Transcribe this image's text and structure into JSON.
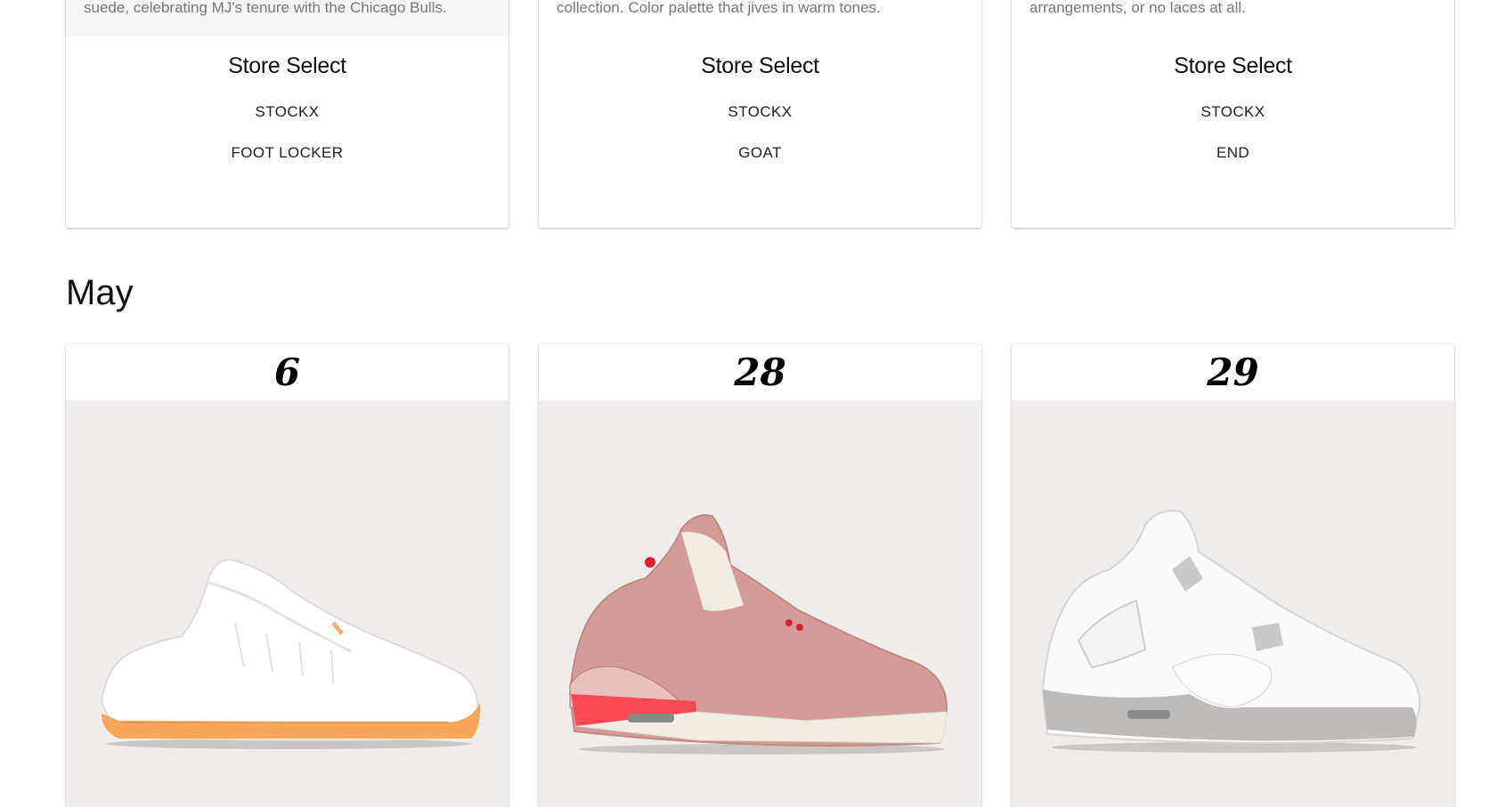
{
  "top_cards": [
    {
      "description": "suede, celebrating MJ's tenure with the Chicago Bulls.",
      "store_title": "Store Select",
      "stores": [
        "STOCKX",
        "FOOT LOCKER"
      ]
    },
    {
      "description": "collection. Color palette that jives in warm tones.",
      "store_title": "Store Select",
      "stores": [
        "STOCKX",
        "GOAT"
      ]
    },
    {
      "description": "arrangements, or no laces at all.",
      "store_title": "Store Select",
      "stores": [
        "STOCKX",
        "END"
      ]
    }
  ],
  "month": "May",
  "releases": [
    {
      "day": "6",
      "image": "white-sneaker-orange-sole-image"
    },
    {
      "day": "28",
      "image": "pink-sneaker-image"
    },
    {
      "day": "29",
      "image": "white-grey-sneaker-image"
    }
  ],
  "colors": {
    "photo_bg": "#efedec",
    "card_bg": "#ffffff",
    "desc_bg": "#f6f6f6"
  }
}
